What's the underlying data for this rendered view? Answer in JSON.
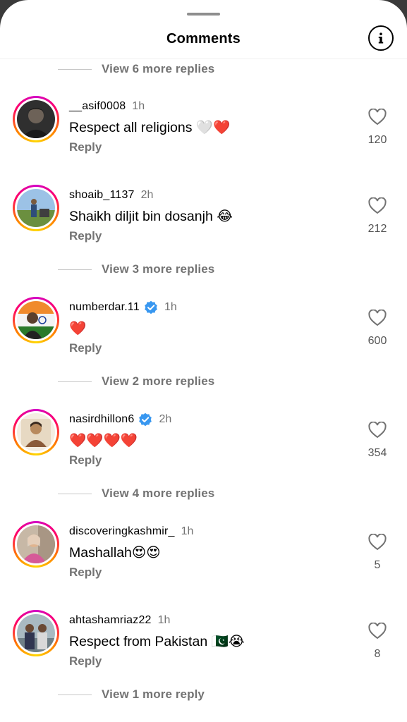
{
  "header": {
    "title": "Comments",
    "info_icon": "info-icon"
  },
  "threads": [
    {
      "view_more": "View 6 more replies"
    },
    {
      "username": "__asif0008",
      "verified": false,
      "time": "1h",
      "text": "Respect all religions 🤍❤️",
      "reply": "Reply",
      "likes": "120",
      "avatar": {
        "bg": "#3b3b3b",
        "skin": "#8a7a6a"
      }
    },
    {
      "username": "shoaib_1137",
      "verified": false,
      "time": "2h",
      "text": "Shaikh diljit bin dosanjh 😂",
      "reply": "Reply",
      "likes": "212",
      "avatar": {
        "bg": "#8fb6d8",
        "skin": "#5d7c3a"
      },
      "view_more": "View 3 more replies"
    },
    {
      "username": "numberdar.11",
      "verified": true,
      "time": "1h",
      "text": "❤️",
      "reply": "Reply",
      "likes": "600",
      "avatar": {
        "bg": "#e9a060",
        "skin": "#2b5f2b"
      },
      "view_more": "View 2 more replies"
    },
    {
      "username": "nasirdhillon6",
      "verified": true,
      "time": "2h",
      "text": "❤️❤️❤️❤️",
      "reply": "Reply",
      "likes": "354",
      "avatar": {
        "bg": "#f3ece0",
        "skin": "#7b5a3a"
      },
      "view_more": "View 4 more replies"
    },
    {
      "username": "discoveringkashmir_",
      "verified": false,
      "time": "1h",
      "text": "Mashallah😍😍",
      "reply": "Reply",
      "likes": "5",
      "avatar": {
        "bg": "#c9b9a8",
        "skin": "#d86aa0"
      }
    },
    {
      "username": "ahtashamriaz22",
      "verified": false,
      "time": "1h",
      "text": "Respect from Pakistan 🇵🇰😭",
      "reply": "Reply",
      "likes": "8",
      "avatar": {
        "bg": "#9fb0b8",
        "skin": "#3a3f55"
      },
      "view_more": "View 1 more reply"
    }
  ],
  "colors": {
    "verified": "#3897f0",
    "secondary_text": "#737373",
    "ring_start": "#d300c5",
    "ring_end": "#ffd600"
  }
}
